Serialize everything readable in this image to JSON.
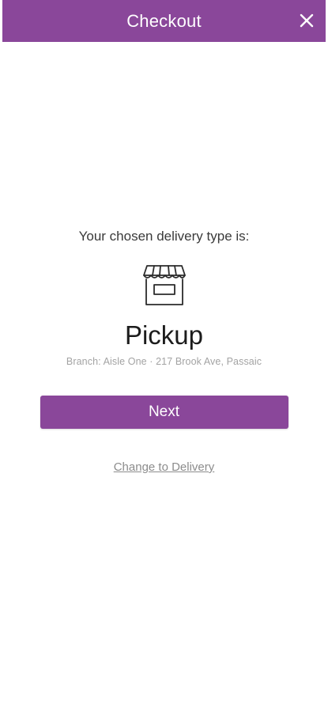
{
  "header": {
    "title": "Checkout",
    "close_icon": "close-icon",
    "background": "#8a479a"
  },
  "main": {
    "prompt": "Your chosen delivery type is:",
    "delivery_icon": "storefront-icon",
    "delivery_type": "Pickup",
    "branch_line": "Branch: Aisle One · 217 Brook Ave, Passaic",
    "next_label": "Next",
    "change_link": "Change to Delivery"
  },
  "colors": {
    "accent": "#8a479a",
    "text_dark": "#1c1c1c",
    "text_muted": "#a3a3a3",
    "link": "#8c8c8c"
  }
}
